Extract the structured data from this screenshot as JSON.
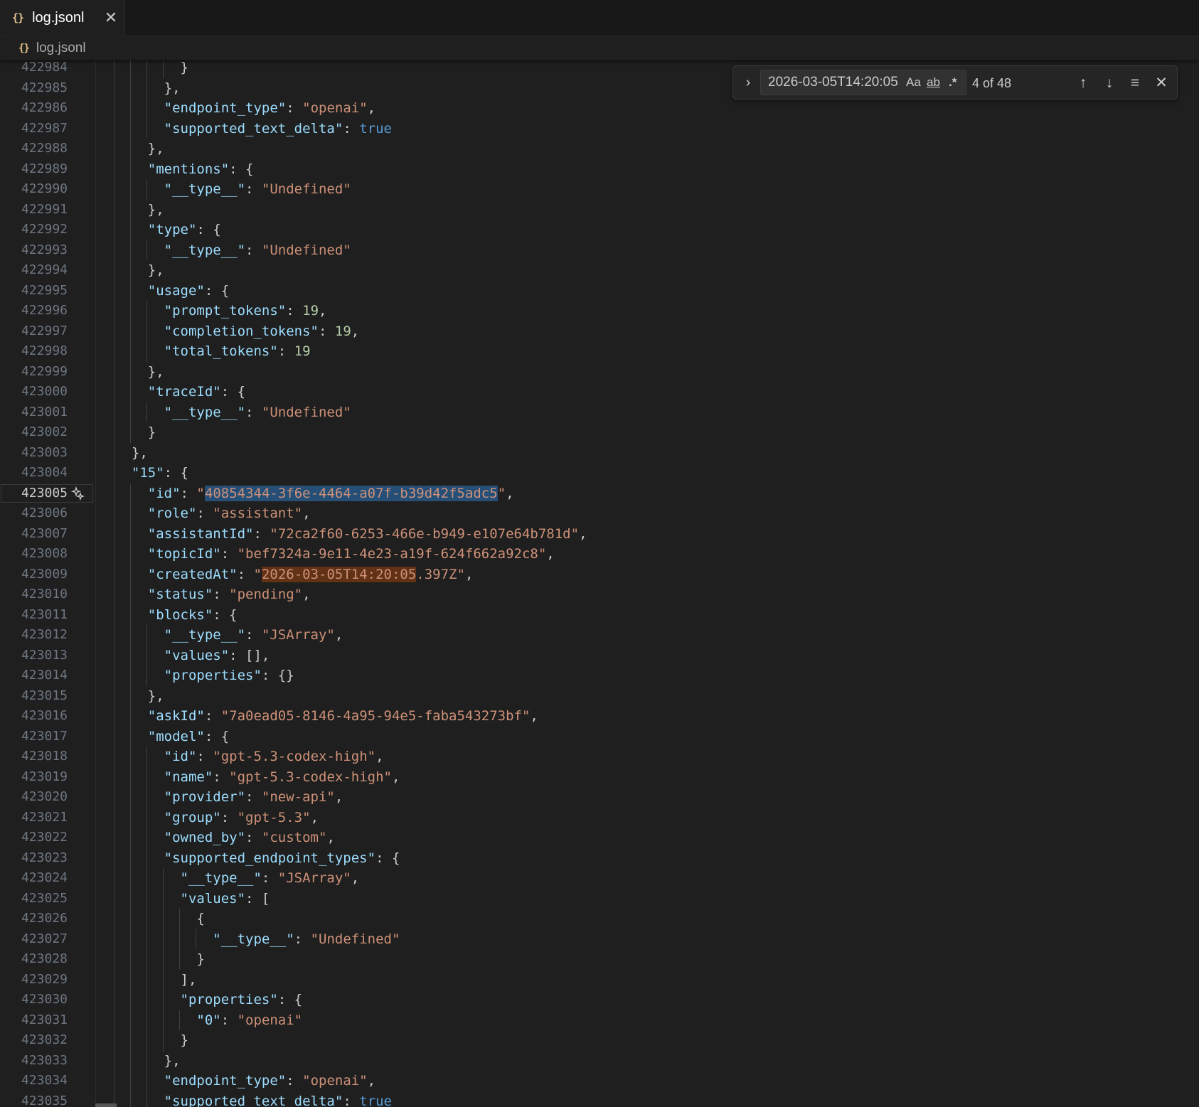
{
  "tab": {
    "icon": "json-braces-icon",
    "label": "log.jsonl",
    "close": "✕"
  },
  "breadcrumb": {
    "icon": "json-braces-icon",
    "label": "log.jsonl"
  },
  "find": {
    "query": "2026-03-05T14:20:05",
    "match_case": "Aa",
    "whole_word": "ab",
    "regex": ".*",
    "count": "4 of 48",
    "prev": "↑",
    "next": "↓",
    "in_selection": "≡",
    "close": "✕"
  },
  "editor": {
    "current_line": "423005",
    "lines": [
      {
        "n": "422984",
        "t": [
          [
            "p",
            "        }"
          ]
        ]
      },
      {
        "n": "422985",
        "t": [
          [
            "p",
            "      },"
          ]
        ]
      },
      {
        "n": "422986",
        "t": [
          [
            "p",
            "      "
          ],
          [
            "k",
            "\"endpoint_type\""
          ],
          [
            "p",
            ": "
          ],
          [
            "s",
            "\"openai\""
          ],
          [
            "p",
            ","
          ]
        ]
      },
      {
        "n": "422987",
        "t": [
          [
            "p",
            "      "
          ],
          [
            "k",
            "\"supported_text_delta\""
          ],
          [
            "p",
            ": "
          ],
          [
            "b",
            "true"
          ]
        ]
      },
      {
        "n": "422988",
        "t": [
          [
            "p",
            "    },"
          ]
        ]
      },
      {
        "n": "422989",
        "t": [
          [
            "p",
            "    "
          ],
          [
            "k",
            "\"mentions\""
          ],
          [
            "p",
            ": {"
          ]
        ]
      },
      {
        "n": "422990",
        "t": [
          [
            "p",
            "      "
          ],
          [
            "k",
            "\"__type__\""
          ],
          [
            "p",
            ": "
          ],
          [
            "s",
            "\"Undefined\""
          ]
        ]
      },
      {
        "n": "422991",
        "t": [
          [
            "p",
            "    },"
          ]
        ]
      },
      {
        "n": "422992",
        "t": [
          [
            "p",
            "    "
          ],
          [
            "k",
            "\"type\""
          ],
          [
            "p",
            ": {"
          ]
        ]
      },
      {
        "n": "422993",
        "t": [
          [
            "p",
            "      "
          ],
          [
            "k",
            "\"__type__\""
          ],
          [
            "p",
            ": "
          ],
          [
            "s",
            "\"Undefined\""
          ]
        ]
      },
      {
        "n": "422994",
        "t": [
          [
            "p",
            "    },"
          ]
        ]
      },
      {
        "n": "422995",
        "t": [
          [
            "p",
            "    "
          ],
          [
            "k",
            "\"usage\""
          ],
          [
            "p",
            ": {"
          ]
        ]
      },
      {
        "n": "422996",
        "t": [
          [
            "p",
            "      "
          ],
          [
            "k",
            "\"prompt_tokens\""
          ],
          [
            "p",
            ": "
          ],
          [
            "n",
            "19"
          ],
          [
            "p",
            ","
          ]
        ]
      },
      {
        "n": "422997",
        "t": [
          [
            "p",
            "      "
          ],
          [
            "k",
            "\"completion_tokens\""
          ],
          [
            "p",
            ": "
          ],
          [
            "n",
            "19"
          ],
          [
            "p",
            ","
          ]
        ]
      },
      {
        "n": "422998",
        "t": [
          [
            "p",
            "      "
          ],
          [
            "k",
            "\"total_tokens\""
          ],
          [
            "p",
            ": "
          ],
          [
            "n",
            "19"
          ]
        ]
      },
      {
        "n": "422999",
        "t": [
          [
            "p",
            "    },"
          ]
        ]
      },
      {
        "n": "423000",
        "t": [
          [
            "p",
            "    "
          ],
          [
            "k",
            "\"traceId\""
          ],
          [
            "p",
            ": {"
          ]
        ]
      },
      {
        "n": "423001",
        "t": [
          [
            "p",
            "      "
          ],
          [
            "k",
            "\"__type__\""
          ],
          [
            "p",
            ": "
          ],
          [
            "s",
            "\"Undefined\""
          ]
        ]
      },
      {
        "n": "423002",
        "t": [
          [
            "p",
            "    }"
          ]
        ]
      },
      {
        "n": "423003",
        "t": [
          [
            "p",
            "  },"
          ]
        ]
      },
      {
        "n": "423004",
        "t": [
          [
            "p",
            "  "
          ],
          [
            "k",
            "\"15\""
          ],
          [
            "p",
            ": {"
          ]
        ]
      },
      {
        "n": "423005",
        "t": [
          [
            "p",
            "    "
          ],
          [
            "k",
            "\"id\""
          ],
          [
            "p",
            ": "
          ],
          [
            "s",
            "\""
          ],
          [
            "sel",
            "40854344-3f6e-4464-a07f-b39d42f5adc5"
          ],
          [
            "s",
            "\""
          ],
          [
            "p",
            ","
          ]
        ]
      },
      {
        "n": "423006",
        "t": [
          [
            "p",
            "    "
          ],
          [
            "k",
            "\"role\""
          ],
          [
            "p",
            ": "
          ],
          [
            "s",
            "\"assistant\""
          ],
          [
            "p",
            ","
          ]
        ]
      },
      {
        "n": "423007",
        "t": [
          [
            "p",
            "    "
          ],
          [
            "k",
            "\"assistantId\""
          ],
          [
            "p",
            ": "
          ],
          [
            "s",
            "\"72ca2f60-6253-466e-b949-e107e64b781d\""
          ],
          [
            "p",
            ","
          ]
        ]
      },
      {
        "n": "423008",
        "t": [
          [
            "p",
            "    "
          ],
          [
            "k",
            "\"topicId\""
          ],
          [
            "p",
            ": "
          ],
          [
            "s",
            "\"bef7324a-9e11-4e23-a19f-624f662a92c8\""
          ],
          [
            "p",
            ","
          ]
        ]
      },
      {
        "n": "423009",
        "t": [
          [
            "p",
            "    "
          ],
          [
            "k",
            "\"createdAt\""
          ],
          [
            "p",
            ": "
          ],
          [
            "s",
            "\""
          ],
          [
            "match",
            "2026-03-05T14:20:05"
          ],
          [
            "s",
            ".397Z\""
          ],
          [
            "p",
            ","
          ]
        ]
      },
      {
        "n": "423010",
        "t": [
          [
            "p",
            "    "
          ],
          [
            "k",
            "\"status\""
          ],
          [
            "p",
            ": "
          ],
          [
            "s",
            "\"pending\""
          ],
          [
            "p",
            ","
          ]
        ]
      },
      {
        "n": "423011",
        "t": [
          [
            "p",
            "    "
          ],
          [
            "k",
            "\"blocks\""
          ],
          [
            "p",
            ": {"
          ]
        ]
      },
      {
        "n": "423012",
        "t": [
          [
            "p",
            "      "
          ],
          [
            "k",
            "\"__type__\""
          ],
          [
            "p",
            ": "
          ],
          [
            "s",
            "\"JSArray\""
          ],
          [
            "p",
            ","
          ]
        ]
      },
      {
        "n": "423013",
        "t": [
          [
            "p",
            "      "
          ],
          [
            "k",
            "\"values\""
          ],
          [
            "p",
            ": [],"
          ]
        ]
      },
      {
        "n": "423014",
        "t": [
          [
            "p",
            "      "
          ],
          [
            "k",
            "\"properties\""
          ],
          [
            "p",
            ": {}"
          ]
        ]
      },
      {
        "n": "423015",
        "t": [
          [
            "p",
            "    },"
          ]
        ]
      },
      {
        "n": "423016",
        "t": [
          [
            "p",
            "    "
          ],
          [
            "k",
            "\"askId\""
          ],
          [
            "p",
            ": "
          ],
          [
            "s",
            "\"7a0ead05-8146-4a95-94e5-faba543273bf\""
          ],
          [
            "p",
            ","
          ]
        ]
      },
      {
        "n": "423017",
        "t": [
          [
            "p",
            "    "
          ],
          [
            "k",
            "\"model\""
          ],
          [
            "p",
            ": {"
          ]
        ]
      },
      {
        "n": "423018",
        "t": [
          [
            "p",
            "      "
          ],
          [
            "k",
            "\"id\""
          ],
          [
            "p",
            ": "
          ],
          [
            "s",
            "\"gpt-5.3-codex-high\""
          ],
          [
            "p",
            ","
          ]
        ]
      },
      {
        "n": "423019",
        "t": [
          [
            "p",
            "      "
          ],
          [
            "k",
            "\"name\""
          ],
          [
            "p",
            ": "
          ],
          [
            "s",
            "\"gpt-5.3-codex-high\""
          ],
          [
            "p",
            ","
          ]
        ]
      },
      {
        "n": "423020",
        "t": [
          [
            "p",
            "      "
          ],
          [
            "k",
            "\"provider\""
          ],
          [
            "p",
            ": "
          ],
          [
            "s",
            "\"new-api\""
          ],
          [
            "p",
            ","
          ]
        ]
      },
      {
        "n": "423021",
        "t": [
          [
            "p",
            "      "
          ],
          [
            "k",
            "\"group\""
          ],
          [
            "p",
            ": "
          ],
          [
            "s",
            "\"gpt-5.3\""
          ],
          [
            "p",
            ","
          ]
        ]
      },
      {
        "n": "423022",
        "t": [
          [
            "p",
            "      "
          ],
          [
            "k",
            "\"owned_by\""
          ],
          [
            "p",
            ": "
          ],
          [
            "s",
            "\"custom\""
          ],
          [
            "p",
            ","
          ]
        ]
      },
      {
        "n": "423023",
        "t": [
          [
            "p",
            "      "
          ],
          [
            "k",
            "\"supported_endpoint_types\""
          ],
          [
            "p",
            ": {"
          ]
        ]
      },
      {
        "n": "423024",
        "t": [
          [
            "p",
            "        "
          ],
          [
            "k",
            "\"__type__\""
          ],
          [
            "p",
            ": "
          ],
          [
            "s",
            "\"JSArray\""
          ],
          [
            "p",
            ","
          ]
        ]
      },
      {
        "n": "423025",
        "t": [
          [
            "p",
            "        "
          ],
          [
            "k",
            "\"values\""
          ],
          [
            "p",
            ": ["
          ]
        ]
      },
      {
        "n": "423026",
        "t": [
          [
            "p",
            "          {"
          ]
        ]
      },
      {
        "n": "423027",
        "t": [
          [
            "p",
            "            "
          ],
          [
            "k",
            "\"__type__\""
          ],
          [
            "p",
            ": "
          ],
          [
            "s",
            "\"Undefined\""
          ]
        ]
      },
      {
        "n": "423028",
        "t": [
          [
            "p",
            "          }"
          ]
        ]
      },
      {
        "n": "423029",
        "t": [
          [
            "p",
            "        ],"
          ]
        ]
      },
      {
        "n": "423030",
        "t": [
          [
            "p",
            "        "
          ],
          [
            "k",
            "\"properties\""
          ],
          [
            "p",
            ": {"
          ]
        ]
      },
      {
        "n": "423031",
        "t": [
          [
            "p",
            "          "
          ],
          [
            "k",
            "\"0\""
          ],
          [
            "p",
            ": "
          ],
          [
            "s",
            "\"openai\""
          ]
        ]
      },
      {
        "n": "423032",
        "t": [
          [
            "p",
            "        }"
          ]
        ]
      },
      {
        "n": "423033",
        "t": [
          [
            "p",
            "      },"
          ]
        ]
      },
      {
        "n": "423034",
        "t": [
          [
            "p",
            "      "
          ],
          [
            "k",
            "\"endpoint_type\""
          ],
          [
            "p",
            ": "
          ],
          [
            "s",
            "\"openai\""
          ],
          [
            "p",
            ","
          ]
        ]
      },
      {
        "n": "423035",
        "t": [
          [
            "p",
            "      "
          ],
          [
            "k",
            "\"supported_text_delta\""
          ],
          [
            "p",
            ": "
          ],
          [
            "b",
            "true"
          ]
        ]
      }
    ]
  }
}
